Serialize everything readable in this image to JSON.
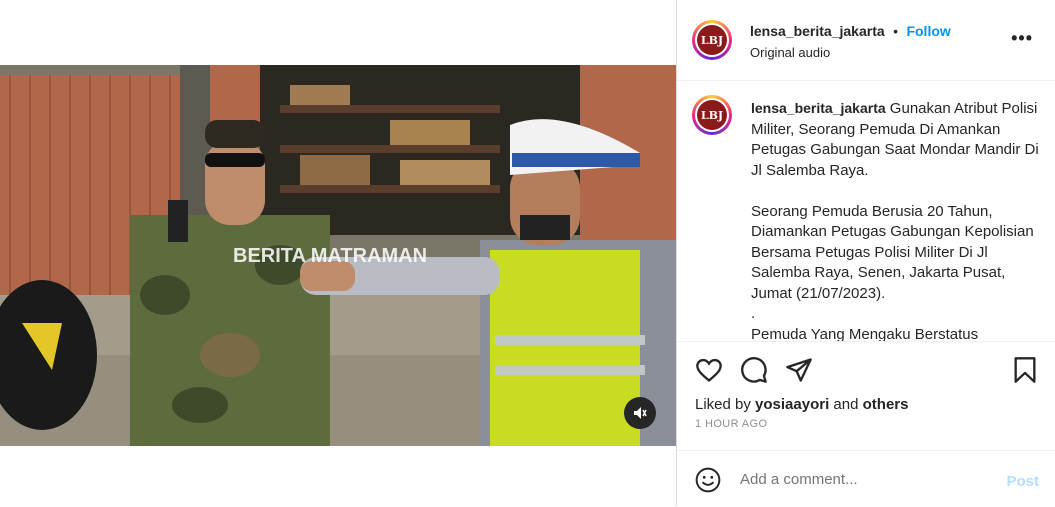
{
  "video": {
    "watermark": "BERITA MATRAMAN",
    "mute_icon": "speaker-muted-icon"
  },
  "post_header": {
    "avatar_initials": "LBJ",
    "username": "lensa_berita_jakarta",
    "separator": "•",
    "follow_label": "Follow",
    "audio_label": "Original audio",
    "more_label": "•••"
  },
  "caption": {
    "username": "lensa_berita_jakarta",
    "text": " Gunakan Atribut Polisi Militer, Seorang Pemuda Di Amankan Petugas Gabungan Saat Mondar Mandir Di Jl Salemba Raya.\n\nSeorang Pemuda Berusia 20 Tahun, Diamankan Petugas Gabungan Kepolisian Bersama Petugas Polisi Militer Di Jl Salemba Raya, Senen, Jakarta Pusat, Jumat (21/07/2023).\n.\nPemuda Yang Mengaku Berstatus"
  },
  "actions": {
    "like_icon": "heart-icon",
    "comment_icon": "comment-icon",
    "share_icon": "share-icon",
    "save_icon": "bookmark-icon",
    "liked_by_prefix": "Liked by ",
    "liked_by_user": "yosiaayori",
    "liked_by_and": " and ",
    "liked_by_others": "others",
    "timestamp": "1 HOUR AGO"
  },
  "comment": {
    "emoji_icon": "emoji-icon",
    "placeholder": "Add a comment...",
    "post_label": "Post"
  }
}
